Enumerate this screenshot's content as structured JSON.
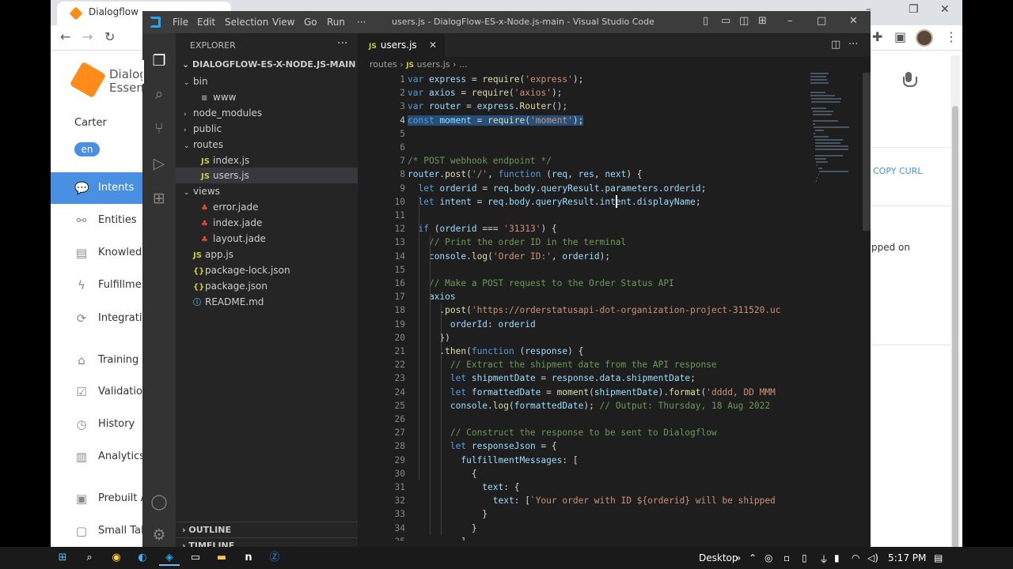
{
  "browser": {
    "tab_title": "Dialogflow",
    "controls": {
      "minimize": "–",
      "restore": "❐",
      "close": "✕"
    }
  },
  "dialogflow": {
    "brand_line1": "Dialog",
    "brand_line2": "Essen",
    "agent": "Carter",
    "lang": "en",
    "nav": [
      {
        "label": "Intents",
        "icon": "chat-icon",
        "glyph": "💬"
      },
      {
        "label": "Entities",
        "icon": "entities-icon",
        "glyph": "⚯"
      },
      {
        "label": "Knowledg",
        "icon": "book-icon",
        "glyph": "▤"
      },
      {
        "label": "Fulfillmen",
        "icon": "lightning-icon",
        "glyph": "ϟ"
      },
      {
        "label": "Integratio",
        "icon": "refresh-icon",
        "glyph": "⟳"
      },
      {
        "label": "Training",
        "icon": "graduation-icon",
        "glyph": "⌂"
      },
      {
        "label": "Validation",
        "icon": "check-icon",
        "glyph": "☑"
      },
      {
        "label": "History",
        "icon": "clock-icon",
        "glyph": "◷"
      },
      {
        "label": "Analytics",
        "icon": "chart-icon",
        "glyph": "▥"
      },
      {
        "label": "Prebuilt A",
        "icon": "template-icon",
        "glyph": "▣"
      },
      {
        "label": "Small Talk",
        "icon": "talk-icon",
        "glyph": "▢"
      }
    ],
    "copy_curl": "COPY CURL",
    "shipped_text": "pped on"
  },
  "vscode": {
    "menu": [
      "File",
      "Edit",
      "Selection",
      "View",
      "Go",
      "Run",
      "···"
    ],
    "title": "users.js - DialogFlow-ES-x-Node.js-main - Visual Studio Code",
    "explorer_label": "EXPLORER",
    "explorer_more": "···",
    "project": "DIALOGFLOW-ES-X-NODE.JS-MAIN",
    "tree": [
      {
        "label": "bin",
        "indent": 1,
        "twisty": "⌄",
        "icon": ""
      },
      {
        "label": "www",
        "indent": 2,
        "twisty": "",
        "icon": "≡"
      },
      {
        "label": "node_modules",
        "indent": 1,
        "twisty": "›",
        "icon": ""
      },
      {
        "label": "public",
        "indent": 1,
        "twisty": "›",
        "icon": ""
      },
      {
        "label": "routes",
        "indent": 1,
        "twisty": "⌄",
        "icon": ""
      },
      {
        "label": "index.js",
        "indent": 2,
        "twisty": "",
        "icon": "JS"
      },
      {
        "label": "users.js",
        "indent": 2,
        "twisty": "",
        "icon": "JS",
        "selected": true
      },
      {
        "label": "views",
        "indent": 1,
        "twisty": "⌄",
        "icon": ""
      },
      {
        "label": "error.jade",
        "indent": 2,
        "twisty": "",
        "icon": "♣"
      },
      {
        "label": "index.jade",
        "indent": 2,
        "twisty": "",
        "icon": "♣"
      },
      {
        "label": "layout.jade",
        "indent": 2,
        "twisty": "",
        "icon": "♣"
      },
      {
        "label": "app.js",
        "indent": 1,
        "twisty": "",
        "icon": "JS"
      },
      {
        "label": "package-lock.json",
        "indent": 1,
        "twisty": "",
        "icon": "{}"
      },
      {
        "label": "package.json",
        "indent": 1,
        "twisty": "",
        "icon": "{}"
      },
      {
        "label": "README.md",
        "indent": 1,
        "twisty": "",
        "icon": "ⓘ"
      }
    ],
    "outline": "OUTLINE",
    "timeline": "TIMELINE",
    "tab_label": "users.js",
    "tab_js": "JS",
    "tab_close": "✕",
    "breadcrumb": {
      "folder": "routes",
      "sep": "›",
      "file": "users.js",
      "tail": "› ..."
    },
    "current_line": 4,
    "code": [
      {
        "n": "1",
        "t": "var express = require('express');"
      },
      {
        "n": "2",
        "t": "var axios = require('axios');"
      },
      {
        "n": "3",
        "t": "var router = express.Router();"
      },
      {
        "n": "4",
        "t": "const moment = require('moment');"
      },
      {
        "n": "5",
        "t": ""
      },
      {
        "n": "6",
        "t": ""
      },
      {
        "n": "7",
        "t": "/* POST webhook endpoint */"
      },
      {
        "n": "8",
        "t": "router.post('/', function (req, res, next) {"
      },
      {
        "n": "9",
        "t": "  let orderid = req.body.queryResult.parameters.orderid;"
      },
      {
        "n": "10",
        "t": "  let intent = req.body.queryResult.intent.displayName;"
      },
      {
        "n": "11",
        "t": ""
      },
      {
        "n": "12",
        "t": "  if (orderid === '31313') {"
      },
      {
        "n": "13",
        "t": "    // Print the order ID in the terminal"
      },
      {
        "n": "14",
        "t": "    console.log('Order ID:', orderid);"
      },
      {
        "n": "15",
        "t": ""
      },
      {
        "n": "16",
        "t": "    // Make a POST request to the Order Status API"
      },
      {
        "n": "17",
        "t": "    axios"
      },
      {
        "n": "18",
        "t": "      .post('https://orderstatusapi-dot-organization-project-311520.uc"
      },
      {
        "n": "19",
        "t": "        orderId: orderid"
      },
      {
        "n": "20",
        "t": "      })"
      },
      {
        "n": "21",
        "t": "      .then(function (response) {"
      },
      {
        "n": "22",
        "t": "        // Extract the shipment date from the API response"
      },
      {
        "n": "23",
        "t": "        let shipmentDate = response.data.shipmentDate;"
      },
      {
        "n": "24",
        "t": "        let formattedDate = moment(shipmentDate).format('dddd, DD MMM"
      },
      {
        "n": "25",
        "t": "        console.log(formattedDate); // Output: Thursday, 18 Aug 2022"
      },
      {
        "n": "26",
        "t": ""
      },
      {
        "n": "27",
        "t": "        // Construct the response to be sent to Dialogflow"
      },
      {
        "n": "28",
        "t": "        let responseJson = {"
      },
      {
        "n": "29",
        "t": "          fulfillmentMessages: ["
      },
      {
        "n": "30",
        "t": "            {"
      },
      {
        "n": "31",
        "t": "              text: {"
      },
      {
        "n": "32",
        "t": "                text: [`Your order with ID ${orderid} will be shipped"
      },
      {
        "n": "33",
        "t": "              }"
      },
      {
        "n": "34",
        "t": "            }"
      },
      {
        "n": "35",
        "t": "          ]"
      }
    ]
  },
  "taskbar": {
    "desktop": "Desktop",
    "chevron": "»",
    "time": "5:17 PM"
  },
  "colors": {
    "keyword": "#569cd6",
    "variable": "#9cdcfe",
    "function": "#dcdcaa",
    "string": "#ce9178",
    "comment": "#6a9955",
    "number": "#b5cea8",
    "accent": "#4a90e2"
  }
}
